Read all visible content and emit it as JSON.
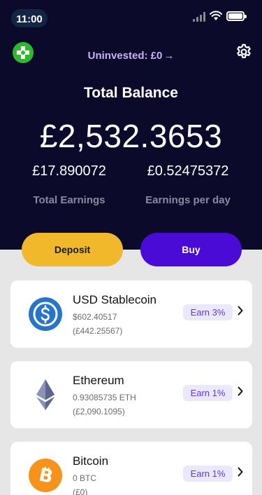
{
  "status_bar": {
    "time": "11:00"
  },
  "header": {
    "uninvested_label": "Uninvested: £0",
    "uninvested_arrow": "→",
    "title": "Total Balance",
    "balance": "£2,532.3653",
    "total_earnings_value": "£17.890072",
    "total_earnings_label": "Total Earnings",
    "earnings_per_day_value": "£0.52475372",
    "earnings_per_day_label": "Earnings per day"
  },
  "actions": {
    "deposit_label": "Deposit",
    "buy_label": "Buy"
  },
  "assets": [
    {
      "name": "USD Stablecoin",
      "amount": "$602.40517",
      "fiat": "(£442.25567)",
      "earn": "Earn 3%",
      "icon": "usdc-icon"
    },
    {
      "name": "Ethereum",
      "amount": "0.93085735 ETH",
      "fiat": "(£2,090.1095)",
      "earn": "Earn 1%",
      "icon": "ethereum-icon"
    },
    {
      "name": "Bitcoin",
      "amount": "0 BTC",
      "fiat": "(£0)",
      "earn": "Earn 1%",
      "icon": "bitcoin-icon"
    }
  ],
  "colors": {
    "header_bg": "#0b0a2b",
    "deposit": "#f0b82a",
    "buy": "#4a0bd6",
    "accent_lavender": "#c7b3f5"
  }
}
